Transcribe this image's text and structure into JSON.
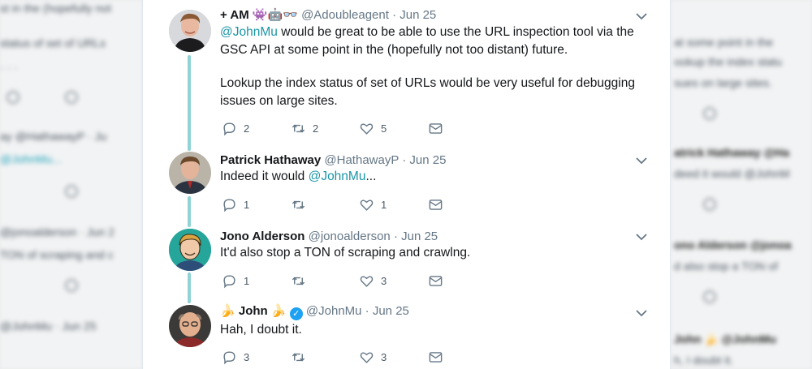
{
  "tweets": [
    {
      "name": "+ AM",
      "name_emojis": "👾🤖👓",
      "handle": "@Adoubleagent",
      "date": "Jun 25",
      "mention": "@JohnMu",
      "text_1": " would be great to be able to use the URL inspection tool via the GSC API at some point in the (hopefully not too distant) future.",
      "text_2": "Lookup the index status of set of URLs would be very useful for debugging issues on large sites.",
      "replies": "2",
      "retweets": "2",
      "likes": "5"
    },
    {
      "name": "Patrick Hathaway",
      "handle": "@HathawayP",
      "date": "Jun 25",
      "text_pre": "Indeed it would ",
      "mention": "@JohnMu",
      "text_post": "...",
      "replies": "1",
      "retweets": "",
      "likes": "1"
    },
    {
      "name": "Jono Alderson",
      "handle": "@jonoalderson",
      "date": "Jun 25",
      "text": "It'd also stop a TON of scraping and crawlng.",
      "replies": "1",
      "retweets": "",
      "likes": "3"
    },
    {
      "name_prefix_emoji": "🍌",
      "name": "John",
      "name_suffix_emoji": "🍌",
      "handle": "@JohnMu",
      "date": "Jun 25",
      "text": "Hah, I doubt it.",
      "replies": "3",
      "retweets": "",
      "likes": "3"
    }
  ],
  "separator": "·",
  "background_left": {
    "lines": [
      "status of set of URLs",
      "ay @HathawayP · Ju",
      "@JohnMu...",
      "@jonoalderson · Jun 2",
      "TON of scraping and c",
      "@JohnMu · Jun 25"
    ]
  },
  "background_right": {
    "lines": [
      "at some point in the",
      "ookup the index statu",
      "sues on large sites.",
      "atrick Hathaway @Ha",
      "deed it would @JohnM",
      "ono Alderson @jonoa",
      "d also stop a TON of",
      "John 🍌 @JohnMu",
      "h, I doubt it."
    ]
  },
  "colors": {
    "thread_line": "#8fd3d5",
    "mention": "#1b95a8",
    "verified": "#1da1f2"
  }
}
